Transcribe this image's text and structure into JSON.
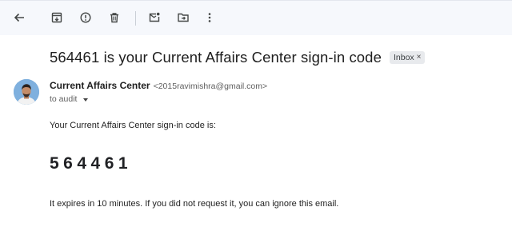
{
  "toolbar": {
    "items": [
      {
        "name": "back-button",
        "icon": "arrow-left-icon"
      },
      {
        "name": "archive-button",
        "icon": "archive-icon"
      },
      {
        "name": "report-spam-button",
        "icon": "report-icon"
      },
      {
        "name": "delete-button",
        "icon": "trash-icon"
      },
      {
        "name": "mark-unread-button",
        "icon": "mark-unread-icon"
      },
      {
        "name": "move-to-button",
        "icon": "move-folder-icon"
      },
      {
        "name": "more-options-button",
        "icon": "more-vertical-icon"
      }
    ]
  },
  "email": {
    "subject": "564461 is your Current Affairs Center sign-in code",
    "label": "Inbox",
    "label_remove": "×",
    "sender_name": "Current Affairs Center",
    "sender_email": "<2015ravimishra@gmail.com>",
    "to_text": "to audit",
    "body_intro": "Your Current Affairs Center sign-in code is:",
    "code": "564461",
    "body_expiry": "It expires in 10 minutes. If you did not request it, you can ignore this email."
  },
  "colors": {
    "toolbar_bg": "#f6f8fc",
    "icon": "#444746",
    "chip_bg": "#e8eaed",
    "text_primary": "#1f1f1f",
    "text_secondary": "#5e5e5e"
  }
}
